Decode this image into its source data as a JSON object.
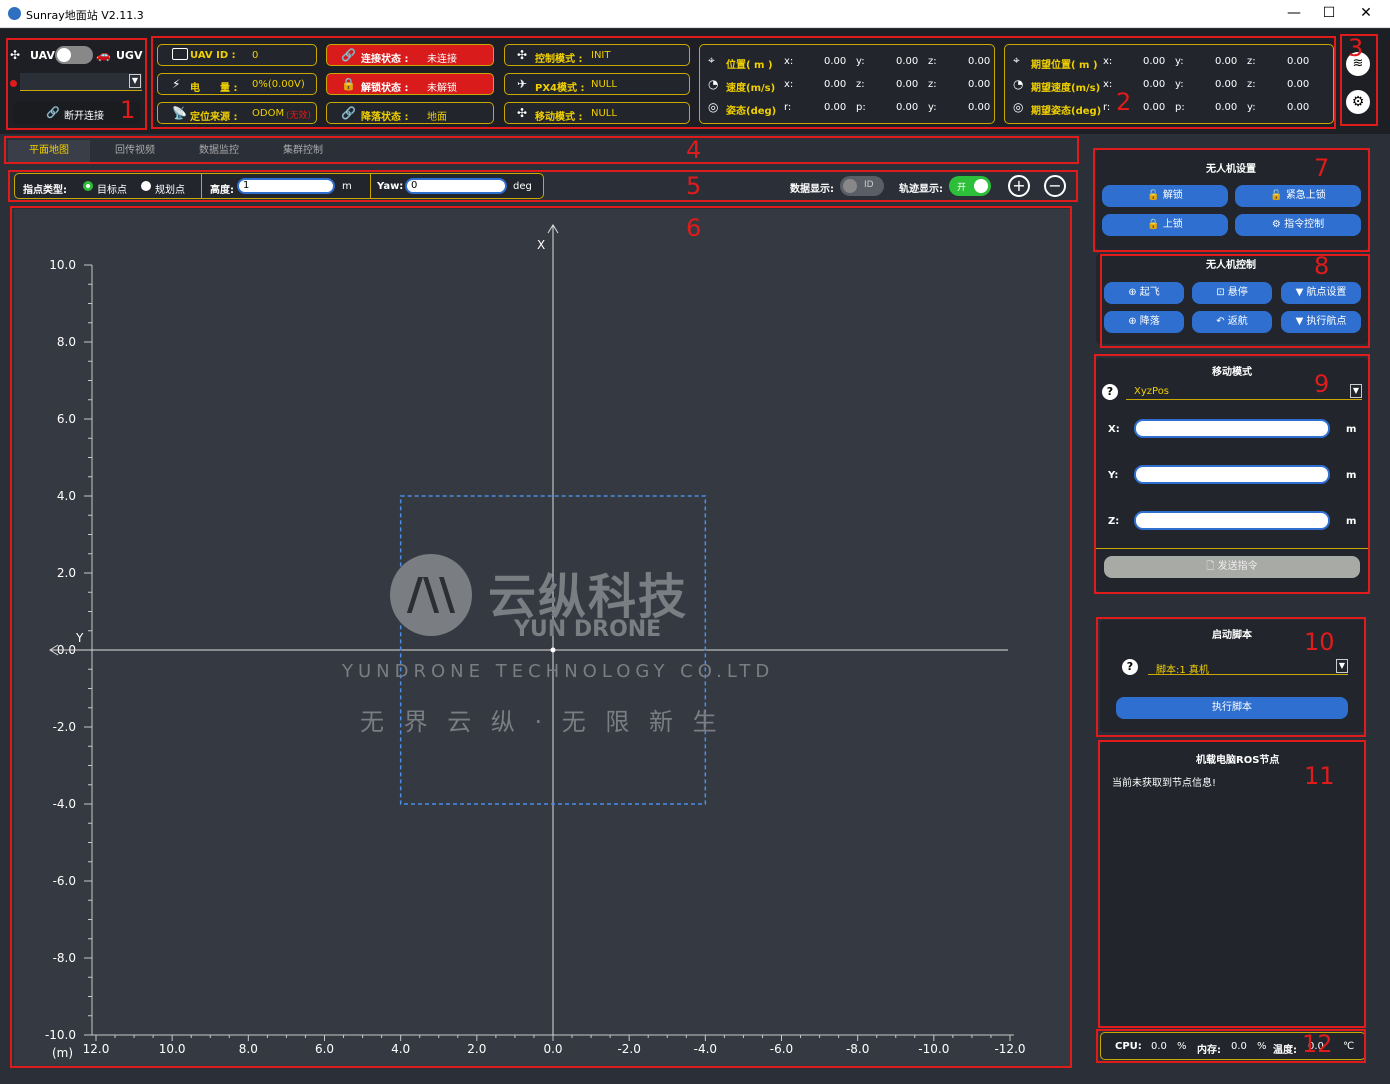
{
  "window": {
    "title": "Sunray地面站 V2.11.3",
    "min": "—",
    "max": "☐",
    "close": "✕"
  },
  "conn": {
    "uav": "UAV",
    "ugv": "UGV",
    "disconnect": "断开连接"
  },
  "status": {
    "uav_id_label": "UAV ID :",
    "uav_id": "0",
    "battery_label": "电　　量 :",
    "battery": "0%(0.00V)",
    "locsrc_label": "定位来源 :",
    "locsrc": "ODOM",
    "locsrc_flag": "(无效)",
    "conn_label": "连接状态 :",
    "conn": "未连接",
    "unlock_label": "解锁状态 :",
    "unlock": "未解锁",
    "land_label": "降落状态 :",
    "land": "地面",
    "ctrl_label": "控制模式 :",
    "ctrl": "INIT",
    "px4_label": "PX4模式 :",
    "px4": "NULL",
    "move_label": "移动模式 :",
    "move": "NULL"
  },
  "state": {
    "pos_label": "位置( m )",
    "vel_label": "速度(m/s)",
    "att_label": "姿态(deg)",
    "rows": [
      [
        "x:",
        "0.00",
        "y:",
        "0.00",
        "z:",
        "0.00"
      ],
      [
        "x:",
        "0.00",
        "z:",
        "0.00",
        "z:",
        "0.00"
      ],
      [
        "r:",
        "0.00",
        "p:",
        "0.00",
        "y:",
        "0.00"
      ]
    ],
    "dpos_label": "期望位置( m )",
    "dvel_label": "期望速度(m/s)",
    "datt_label": "期望姿态(deg)",
    "drows": [
      [
        "x:",
        "0.00",
        "y:",
        "0.00",
        "z:",
        "0.00"
      ],
      [
        "x:",
        "0.00",
        "y:",
        "0.00",
        "z:",
        "0.00"
      ],
      [
        "r:",
        "0.00",
        "p:",
        "0.00",
        "y:",
        "0.00"
      ]
    ]
  },
  "tabs": [
    "平面地图",
    "回传视频",
    "数据监控",
    "集群控制"
  ],
  "toolbar": {
    "type_label": "指点类型:",
    "target": "目标点",
    "plan": "规划点",
    "height_label": "高度:",
    "height": "1",
    "m": "m",
    "yaw_label": "Yaw:",
    "yaw": "0",
    "deg": "deg",
    "data_show": "数据显示:",
    "id": "ID",
    "track_show": "轨迹显示:",
    "on": "开",
    "plus": "+",
    "minus": "−"
  },
  "chart_data": {
    "type": "scatter",
    "ylabel": "X",
    "xlabel": "Y",
    "unit": "(m)",
    "x_ticks": [
      "12.0",
      "10.0",
      "8.0",
      "6.0",
      "4.0",
      "2.0",
      "0.0",
      "-2.0",
      "-4.0",
      "-6.0",
      "-8.0",
      "-10.0",
      "-12.0"
    ],
    "y_ticks": [
      "10.0",
      "8.0",
      "6.0",
      "4.0",
      "2.0",
      "0.0",
      "-2.0",
      "-4.0",
      "-6.0",
      "-8.0",
      "-10.0"
    ],
    "xlim": [
      12,
      -12
    ],
    "ylim": [
      -10,
      10
    ],
    "region": {
      "y_from": 4,
      "y_to": -4,
      "x_from": 4,
      "x_to": -4
    }
  },
  "watermark": {
    "cn": "云纵科技",
    "en": "YUN DRONE",
    "company": "YUNDRONE TECHNOLOGY CO.LTD",
    "slogan": "无 界 云 纵 · 无 限 新 生"
  },
  "setup": {
    "title": "无人机设置",
    "unlock": "解锁",
    "emergency": "紧急上锁",
    "lock": "上锁",
    "cmd": "指令控制"
  },
  "control": {
    "title": "无人机控制",
    "takeoff": "起飞",
    "hover": "悬停",
    "wp_set": "航点设置",
    "land": "降落",
    "rtl": "返航",
    "wp_exec": "执行航点"
  },
  "move": {
    "title": "移动模式",
    "mode": "XyzPos",
    "x": "X:",
    "y": "Y:",
    "z": "Z:",
    "m": "m",
    "send": "发送指令",
    "help": "?"
  },
  "script": {
    "title": "启动脚本",
    "selected": "脚本:1 真机",
    "run": "执行脚本",
    "help": "?"
  },
  "ros": {
    "title": "机载电脑ROS节点",
    "msg": "当前未获取到节点信息!"
  },
  "sys": {
    "cpu": "CPU:",
    "cpu_v": "0.0",
    "pct": "%",
    "mem": "内存:",
    "mem_v": "0.0",
    "temp": "温度:",
    "temp_v": "0.0",
    "c": "℃"
  },
  "marks": [
    "1",
    "2",
    "3",
    "4",
    "5",
    "6",
    "7",
    "8",
    "9",
    "10",
    "11",
    "12"
  ]
}
